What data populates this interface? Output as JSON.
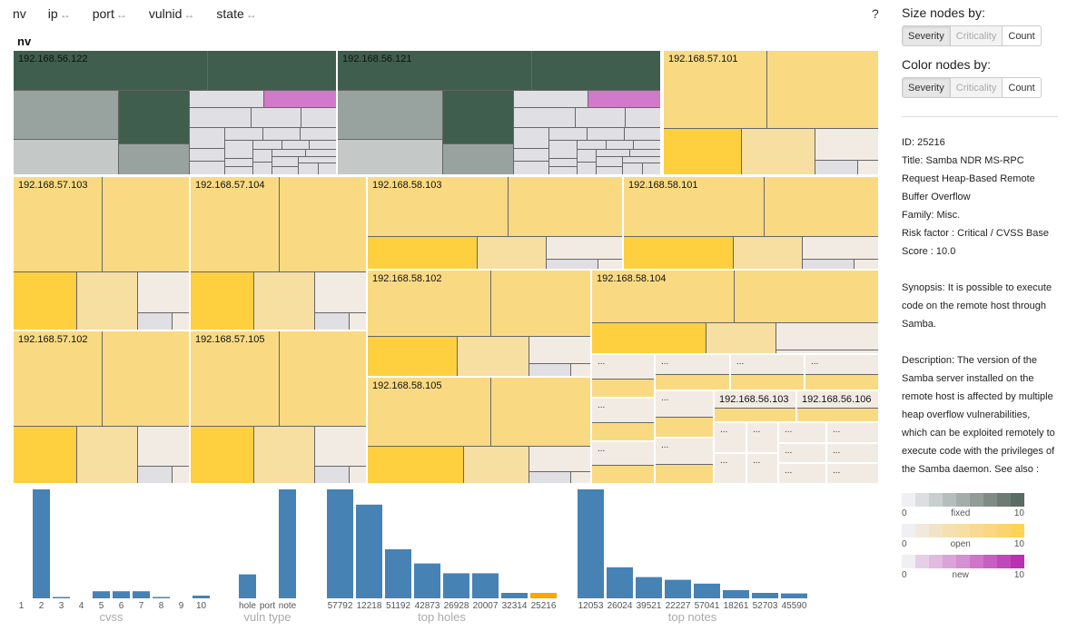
{
  "nav": {
    "items": [
      {
        "label": "nv",
        "arrows": ""
      },
      {
        "label": "ip",
        "arrows": "↔"
      },
      {
        "label": "port",
        "arrows": "↔"
      },
      {
        "label": "vulnid",
        "arrows": "↔"
      },
      {
        "label": "state",
        "arrows": "↔"
      }
    ],
    "help": "?"
  },
  "breadcrumb": "nv",
  "colors": {
    "fixed_dark": "#3f5e4e",
    "fixed_mid": "#98a39f",
    "fixed_light": "#c4c9c8",
    "neutral": "#e0e0e4",
    "new": "#d07ac9",
    "open_high": "#fed03f",
    "open_mid": "#f9da83",
    "open_light": "#f7dfa2",
    "open_pale": "#f1ebe4",
    "bar": "#4682b4",
    "bar_highlight": "#ffa500"
  },
  "treemap": {
    "hosts": [
      "192.168.56.122",
      "192.168.56.121",
      "192.168.57.101",
      "192.168.57.103",
      "192.168.57.104",
      "192.168.58.103",
      "192.168.58.101",
      "192.168.58.102",
      "192.168.58.104",
      "192.168.57.102",
      "192.168.57.105",
      "192.168.58.105",
      "192.168.56.103",
      "192.168.56.106"
    ],
    "ellipsis": "..."
  },
  "sidebar": {
    "size_heading": "Size nodes by:",
    "color_heading": "Color nodes by:",
    "options": [
      "Severity",
      "Criticality",
      "Count"
    ],
    "size_selected": "Severity",
    "color_selected": "Severity",
    "details": {
      "id": "ID: 25216",
      "title_lines": [
        "Title: Samba NDR MS-RPC",
        "Request Heap-Based Remote",
        "Buffer Overflow"
      ],
      "family": "Family: Misc.",
      "risk_lines": [
        "Risk factor : Critical / CVSS Base",
        "Score : 10.0"
      ],
      "synopsis_lines": [
        "Synopsis: It is possible to execute",
        "code on the remote host through",
        "Samba."
      ],
      "description_lines": [
        "Description: The version of the",
        "Samba server installed on the",
        "remote host is affected by multiple",
        "heap overflow vulnerabilities,",
        "which can be exploited remotely to",
        "execute code with the privileges of",
        "the Samba daemon. See also :"
      ]
    },
    "legend": [
      {
        "label": "fixed",
        "min": "0",
        "max": "10",
        "colors": [
          "#efeff4",
          "#dcdee1",
          "#c9cecf",
          "#b6bebd",
          "#a4ada9",
          "#919c97",
          "#7f8c86",
          "#6c7c75",
          "#5a6c63"
        ]
      },
      {
        "label": "open",
        "min": "0",
        "max": "10",
        "colors": [
          "#efeff4",
          "#f1e9dc",
          "#f3e3c6",
          "#f5e0b4",
          "#f7dea4",
          "#f8da92",
          "#fad780",
          "#fcd46d",
          "#fed457"
        ]
      },
      {
        "label": "new",
        "min": "0",
        "max": "10",
        "colors": [
          "#efeff4",
          "#e8cfe8",
          "#e2b9e1",
          "#dba3da",
          "#d58fd3",
          "#cf76cb",
          "#c75fc3",
          "#c148bb",
          "#ba30b2"
        ]
      }
    ]
  },
  "chart_data": [
    {
      "type": "bar",
      "title": "cvss",
      "xlabel": "cvss",
      "categories": [
        "1",
        "2",
        "3",
        "4",
        "5",
        "6",
        "7",
        "8",
        "9",
        "10"
      ],
      "values": [
        0,
        100,
        0.5,
        0,
        6.5,
        6.5,
        6.5,
        0.5,
        0,
        2.5
      ],
      "ylim": [
        0,
        100
      ],
      "highlight": []
    },
    {
      "type": "bar",
      "title": "vuln type",
      "xlabel": "vuln type",
      "categories": [
        "hole",
        "port",
        "note"
      ],
      "values": [
        22,
        0,
        100
      ],
      "ylim": [
        0,
        100
      ],
      "highlight": []
    },
    {
      "type": "bar",
      "title": "top holes",
      "xlabel": "top holes",
      "categories": [
        "57792",
        "12218",
        "51192",
        "42873",
        "26928",
        "20007",
        "32314",
        "25216"
      ],
      "values": [
        100,
        86,
        45,
        32,
        23,
        23,
        5,
        5
      ],
      "ylim": [
        0,
        100
      ],
      "highlight": [
        "25216"
      ]
    },
    {
      "type": "bar",
      "title": "top notes",
      "xlabel": "top notes",
      "categories": [
        "12053",
        "26024",
        "39521",
        "22227",
        "57041",
        "18261",
        "52703",
        "45590"
      ],
      "values": [
        100,
        28.5,
        19.5,
        17,
        13.5,
        7.5,
        5,
        4.5
      ],
      "ylim": [
        0,
        100
      ],
      "highlight": []
    }
  ]
}
